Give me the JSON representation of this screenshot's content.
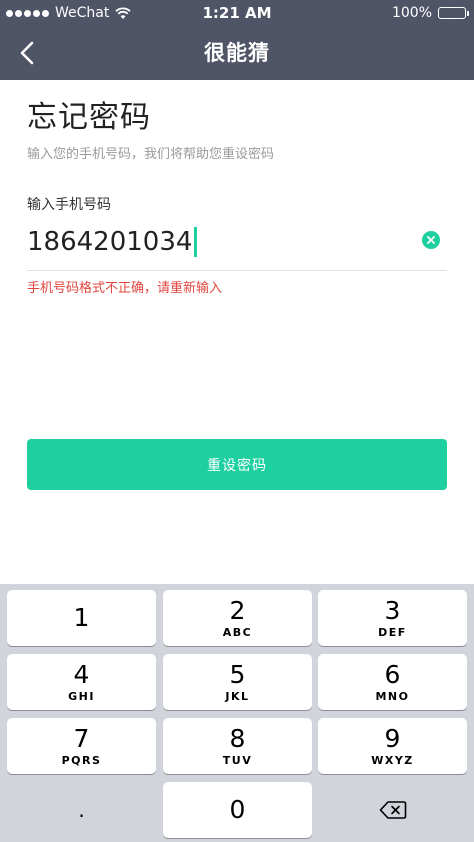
{
  "status_bar": {
    "carrier": "WeChat",
    "time": "1:21 AM",
    "battery": "100%"
  },
  "nav": {
    "title": "很能猜"
  },
  "form": {
    "title": "忘记密码",
    "subtitle": "输入您的手机号码，我们将帮助您重设密码",
    "phone_label": "输入手机号码",
    "phone_value": "1864201034",
    "error": "手机号码格式不正确，请重新输入",
    "submit_label": "重设密码"
  },
  "keypad": {
    "keys": [
      {
        "num": "1",
        "letters": ""
      },
      {
        "num": "2",
        "letters": "ABC"
      },
      {
        "num": "3",
        "letters": "DEF"
      },
      {
        "num": "4",
        "letters": "GHI"
      },
      {
        "num": "5",
        "letters": "JKL"
      },
      {
        "num": "6",
        "letters": "MNO"
      },
      {
        "num": "7",
        "letters": "PQRS"
      },
      {
        "num": "8",
        "letters": "TUV"
      },
      {
        "num": "9",
        "letters": "WXYZ"
      },
      {
        "num": ".",
        "letters": ""
      },
      {
        "num": "0",
        "letters": ""
      }
    ]
  },
  "colors": {
    "accent": "#1ecfa0",
    "nav_bg": "#4f5466",
    "error": "#e0453f"
  },
  "icons": {
    "back": "chevron-left-icon",
    "clear": "clear-circle-icon",
    "delete": "backspace-icon"
  }
}
